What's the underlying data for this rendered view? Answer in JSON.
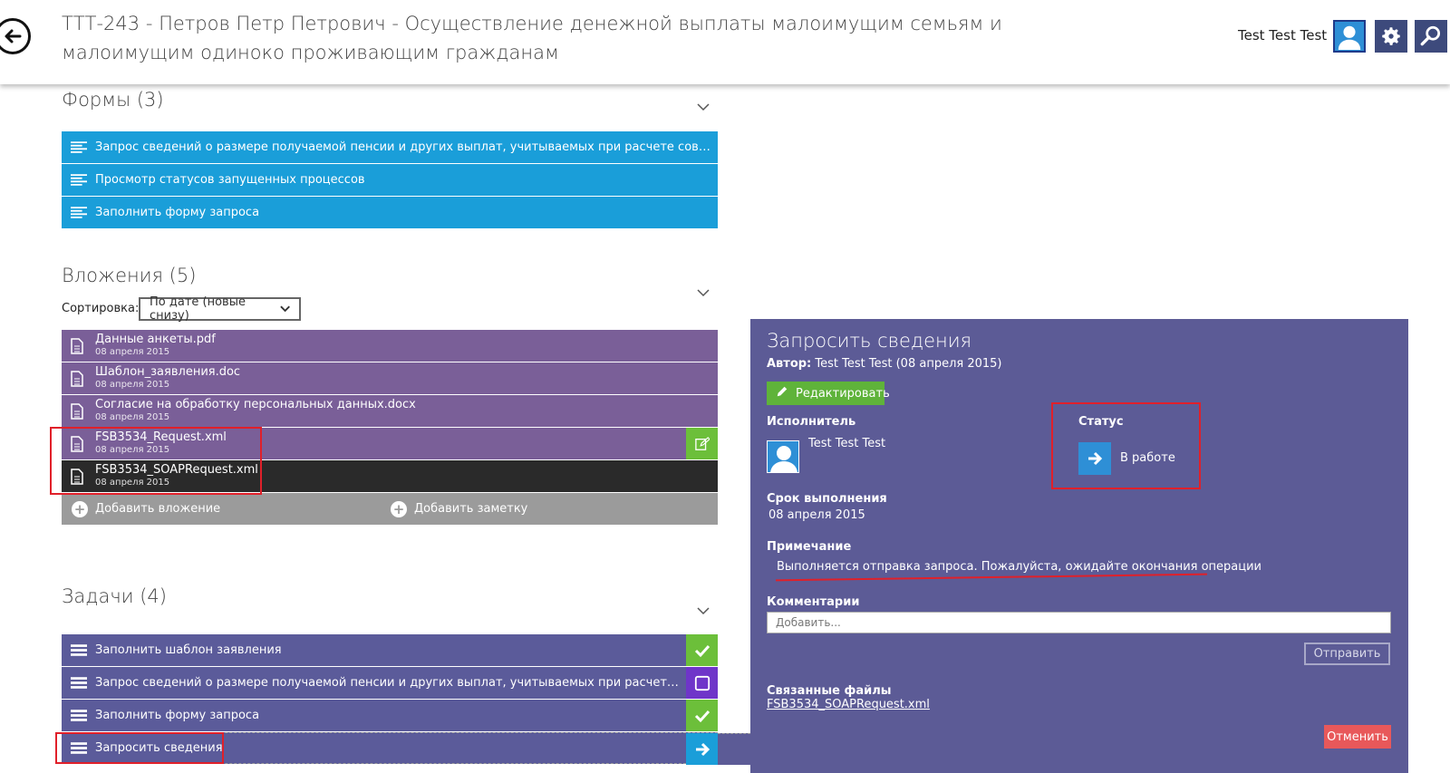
{
  "header": {
    "title": "ТТТ-243 -  Петров Петр  Петрович - Осуществление денежной выплаты малоимущим семьям и малоимущим одиноко проживающим гражданам",
    "user_name": "Test Test Test"
  },
  "forms": {
    "title": "Формы (3)",
    "items": [
      {
        "label": "Запрос сведений о размере получаемой пенсии и других выплат, учитываемых при расчете совокупного до..."
      },
      {
        "label": "Просмотр статусов запущенных процессов"
      },
      {
        "label": "Заполнить форму запроса"
      }
    ]
  },
  "attachments": {
    "title": "Вложения (5)",
    "sort_label": "Сортировка:",
    "sort_value": "По дате (новые снизу)",
    "items": [
      {
        "name": "Данные анкеты.pdf",
        "date": "08 апреля 2015"
      },
      {
        "name": "Шаблон_заявления.doc",
        "date": "08 апреля 2015"
      },
      {
        "name": "Согласие на обработку персональных данных.docx",
        "date": "08 апреля 2015"
      },
      {
        "name": "FSB3534_Request.xml",
        "date": "08 апреля 2015"
      },
      {
        "name": "FSB3534_SOAPRequest.xml",
        "date": "08 апреля 2015"
      }
    ],
    "add_attachment": "Добавить вложение",
    "add_note": "Добавить заметку"
  },
  "tasks": {
    "title": "Задачи (4)",
    "items": [
      {
        "label": "Заполнить шаблон заявления",
        "state": "done"
      },
      {
        "label": "Запрос сведений о размере получаемой пенсии и других выплат, учитываемых при расчете совокупно...",
        "state": "empty"
      },
      {
        "label": "Заполнить форму запроса",
        "state": "done"
      },
      {
        "label": "Запросить сведения",
        "state": "active"
      }
    ]
  },
  "panel": {
    "title": "Запросить сведения",
    "author_label": "Автор:",
    "author_value": "Test Test Test (08 апреля 2015)",
    "edit_button": "Редактировать",
    "executor_label": "Исполнитель",
    "executor_name": "Test Test Test",
    "status_label": "Статус",
    "status_value": "В работе",
    "due_label": "Срок выполнения",
    "due_value": "08 апреля 2015",
    "note_label": "Примечание",
    "note_value": "Выполняется отправка запроса. Пожалуйста, ожидайте окончания операции",
    "comments_label": "Комментарии",
    "comment_placeholder": "Добавить...",
    "send_button": "Отправить",
    "linked_files_label": "Связанные файлы",
    "linked_file": "FSB3534_SOAPRequest.xml",
    "cancel_button": "Отменить"
  },
  "colors": {
    "forms_row": "#1a9ed9",
    "attachment_row": "#7a5f98",
    "task_row": "#5b5b9a",
    "panel_bg": "#5c5b96",
    "annotation_red": "#e0202a"
  }
}
